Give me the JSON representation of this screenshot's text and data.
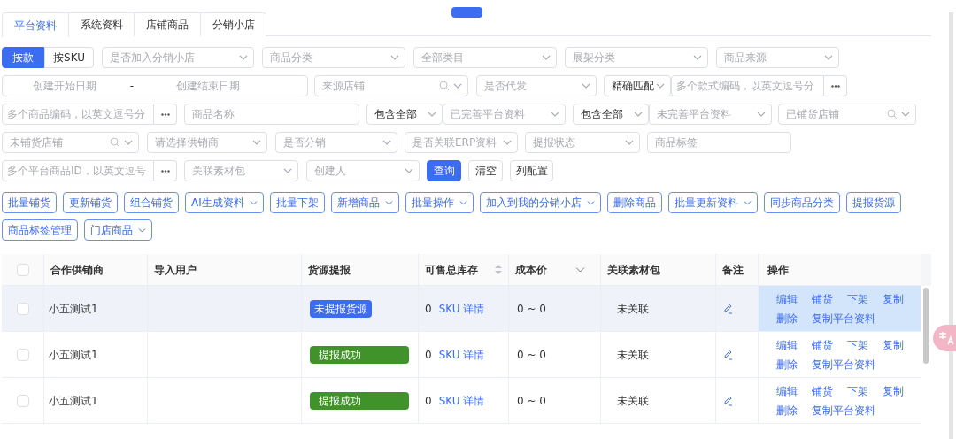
{
  "tabs": [
    {
      "label": "平台资料",
      "selected": true
    },
    {
      "label": "系统资料",
      "selected": false
    },
    {
      "label": "店铺商品",
      "selected": false
    },
    {
      "label": "分销小店",
      "selected": false
    }
  ],
  "filter_rows": [
    [
      {
        "kind": "toggle",
        "options": [
          {
            "label": "按款",
            "selected": true
          },
          {
            "label": "按SKU",
            "selected": false
          }
        ]
      },
      {
        "kind": "select",
        "placeholder": "是否加入分销小店"
      },
      {
        "kind": "select",
        "placeholder": "商品分类"
      },
      {
        "kind": "select",
        "placeholder": "全部类目"
      },
      {
        "kind": "select",
        "placeholder": "展架分类"
      },
      {
        "kind": "select",
        "placeholder": "商品来源"
      }
    ],
    [
      {
        "kind": "date_range",
        "start_placeholder": "创建开始日期",
        "separator": "-",
        "end_placeholder": "创建结束日期"
      },
      {
        "kind": "search_select",
        "placeholder": "来源店铺"
      },
      {
        "kind": "select",
        "placeholder": "是否代发"
      },
      {
        "kind": "select",
        "value": "精确匹配"
      },
      {
        "kind": "input_more",
        "placeholder": "多个款式编码，以英文逗号分"
      }
    ],
    [
      {
        "kind": "input_more",
        "placeholder": "多个商品编码，以英文逗号分"
      },
      {
        "kind": "input",
        "placeholder": "商品名称"
      },
      {
        "kind": "select",
        "value": "包含全部"
      },
      {
        "kind": "select",
        "placeholder": "已完善平台资料"
      },
      {
        "kind": "select",
        "value": "包含全部"
      },
      {
        "kind": "select",
        "placeholder": "未完善平台资料"
      },
      {
        "kind": "search_select",
        "placeholder": "已铺货店铺"
      }
    ],
    [
      {
        "kind": "search_select",
        "placeholder": "未铺货店铺"
      },
      {
        "kind": "select",
        "placeholder": "请选择供销商"
      },
      {
        "kind": "select",
        "placeholder": "是否分销"
      },
      {
        "kind": "select",
        "placeholder": "是否关联ERP资料"
      },
      {
        "kind": "select",
        "placeholder": "提报状态"
      },
      {
        "kind": "input",
        "placeholder": "商品标签"
      }
    ],
    [
      {
        "kind": "input_more",
        "placeholder": "多个平台商品ID，以英文逗号"
      },
      {
        "kind": "select",
        "placeholder": "关联素材包"
      },
      {
        "kind": "select",
        "placeholder": "创建人"
      },
      {
        "kind": "button",
        "label": "查询",
        "primary": true
      },
      {
        "kind": "button",
        "label": "清空",
        "primary": false
      },
      {
        "kind": "button",
        "label": "列配置",
        "primary": false
      }
    ]
  ],
  "toolbar_rows": [
    [
      {
        "label": "批量铺货",
        "dropdown": false
      },
      {
        "label": "更新铺货",
        "dropdown": false
      },
      {
        "label": "组合铺货",
        "dropdown": false
      },
      {
        "label": "AI生成资料",
        "dropdown": true
      },
      {
        "label": "批量下架",
        "dropdown": false
      },
      {
        "label": "新增商品",
        "dropdown": true
      },
      {
        "label": "批量操作",
        "dropdown": true
      },
      {
        "label": "加入到我的分销小店",
        "dropdown": true
      },
      {
        "label": "删除商品",
        "dropdown": false
      },
      {
        "label": "批量更新资料",
        "dropdown": true
      },
      {
        "label": "同步商品分类",
        "dropdown": false
      },
      {
        "label": "提报货源",
        "dropdown": false
      }
    ],
    [
      {
        "label": "商品标签管理",
        "dropdown": false
      },
      {
        "label": "门店商品",
        "dropdown": true
      }
    ]
  ],
  "table": {
    "header_checked": false,
    "columns": [
      {
        "label": "合作供销商"
      },
      {
        "label": "导入用户"
      },
      {
        "label": "货源提报"
      },
      {
        "label": "可售总库存",
        "sortable": true
      },
      {
        "label": "成本价",
        "filterable": true
      },
      {
        "label": "关联素材包"
      },
      {
        "label": "备注"
      },
      {
        "label": "操作"
      }
    ],
    "rows": [
      {
        "checked": false,
        "highlighted": true,
        "supplier": "小五测试1",
        "status": {
          "label": "未提报货源",
          "kind": "pending"
        },
        "stock": "0",
        "sku_link": "SKU 详情",
        "cost": "0 ~ 0",
        "material": "未关联",
        "actions": [
          [
            "编辑",
            "铺货",
            "下架",
            "复制"
          ],
          [
            "删除",
            "复制平台资料"
          ]
        ]
      },
      {
        "checked": false,
        "highlighted": false,
        "supplier": "小五测试1",
        "status": {
          "label": "提报成功",
          "kind": "success"
        },
        "stock": "0",
        "sku_link": "SKU 详情",
        "cost": "0 ~ 0",
        "material": "未关联",
        "actions": [
          [
            "编辑",
            "铺货",
            "下架",
            "复制"
          ],
          [
            "删除",
            "复制平台资料"
          ]
        ]
      },
      {
        "checked": false,
        "highlighted": false,
        "supplier": "小五测试1",
        "status": {
          "label": "提报成功",
          "kind": "success"
        },
        "stock": "0",
        "sku_link": "SKU 详情",
        "cost": "0 ~ 0",
        "material": "未关联",
        "actions": [
          [
            "编辑",
            "铺货",
            "下架",
            "复制"
          ],
          [
            "删除",
            "复制平台资料"
          ]
        ]
      }
    ]
  }
}
